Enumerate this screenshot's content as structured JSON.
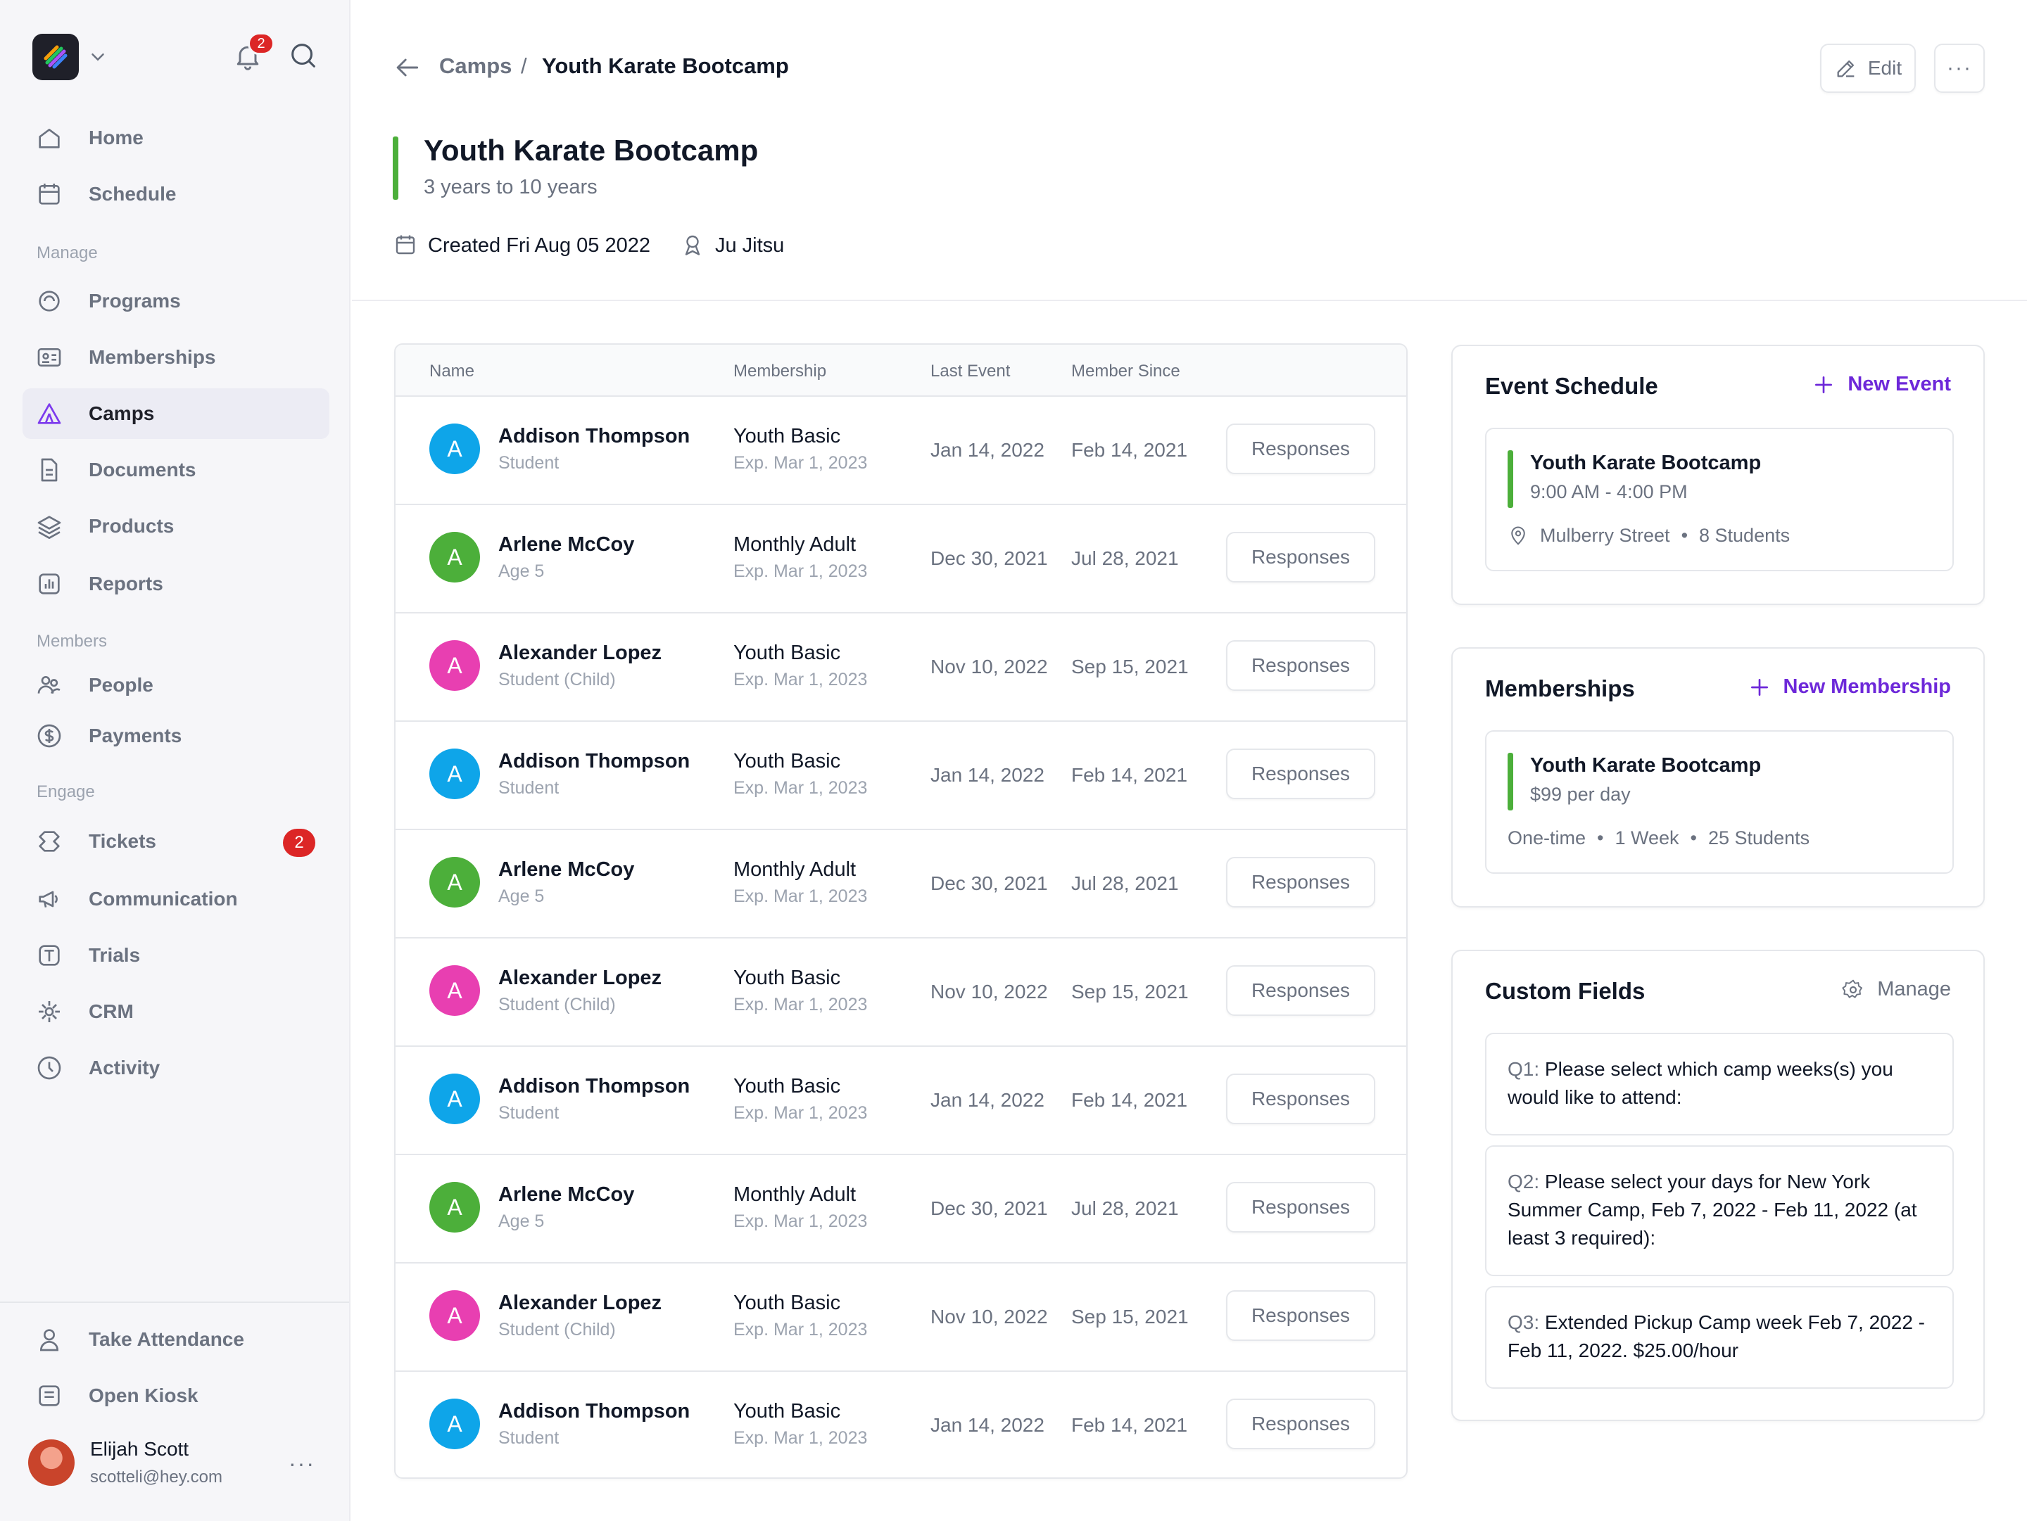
{
  "sidebar": {
    "notification_count": "2",
    "nav": [
      {
        "label": "Home",
        "icon": "home-icon"
      },
      {
        "label": "Schedule",
        "icon": "calendar-icon"
      }
    ],
    "manage_label": "Manage",
    "manage": [
      {
        "label": "Programs",
        "icon": "programs-icon"
      },
      {
        "label": "Memberships",
        "icon": "id-card-icon"
      },
      {
        "label": "Camps",
        "icon": "camp-tent-icon",
        "active": true
      },
      {
        "label": "Documents",
        "icon": "document-icon"
      },
      {
        "label": "Products",
        "icon": "layers-icon"
      },
      {
        "label": "Reports",
        "icon": "chart-icon"
      }
    ],
    "members_label": "Members",
    "members": [
      {
        "label": "People",
        "icon": "people-icon"
      },
      {
        "label": "Payments",
        "icon": "dollar-icon"
      }
    ],
    "engage_label": "Engage",
    "engage": [
      {
        "label": "Tickets",
        "icon": "ticket-icon",
        "badge": "2"
      },
      {
        "label": "Communication",
        "icon": "megaphone-icon"
      },
      {
        "label": "Trials",
        "icon": "trial-icon"
      },
      {
        "label": "CRM",
        "icon": "crm-icon"
      },
      {
        "label": "Activity",
        "icon": "clock-icon"
      }
    ],
    "bottom": [
      {
        "label": "Take Attendance",
        "icon": "user-icon"
      },
      {
        "label": "Open Kiosk",
        "icon": "kiosk-icon"
      }
    ],
    "user": {
      "name": "Elijah Scott",
      "email": "scotteli@hey.com"
    }
  },
  "header": {
    "breadcrumb_parent": "Camps",
    "breadcrumb_sep": "/",
    "breadcrumb_current": "Youth Karate Bootcamp",
    "edit_label": "Edit",
    "more_label": "···"
  },
  "camp": {
    "title": "Youth Karate Bootcamp",
    "subtitle": "3 years to 10 years",
    "created": "Created Fri Aug 05 2022",
    "style": "Ju Jitsu",
    "accent_color": "#4caf3a"
  },
  "table": {
    "columns": {
      "name": "Name",
      "membership": "Membership",
      "last_event": "Last Event",
      "member_since": "Member Since"
    },
    "action_label": "Responses",
    "rows": [
      {
        "initial": "A",
        "color": "#0ea5e9",
        "name": "Addison Thompson",
        "sub": "Student",
        "membership": "Youth Basic",
        "exp": "Exp. Mar 1, 2023",
        "last_event": "Jan 14, 2022",
        "member_since": "Feb 14, 2021"
      },
      {
        "initial": "A",
        "color": "#4caf3a",
        "name": "Arlene McCoy",
        "sub": "Age 5",
        "membership": "Monthly Adult",
        "exp": "Exp. Mar 1, 2023",
        "last_event": "Dec 30, 2021",
        "member_since": "Jul 28, 2021"
      },
      {
        "initial": "A",
        "color": "#e83fb1",
        "name": "Alexander Lopez",
        "sub": "Student (Child)",
        "membership": "Youth Basic",
        "exp": "Exp. Mar 1, 2023",
        "last_event": "Nov 10, 2022",
        "member_since": "Sep 15, 2021"
      },
      {
        "initial": "A",
        "color": "#0ea5e9",
        "name": "Addison Thompson",
        "sub": "Student",
        "membership": "Youth Basic",
        "exp": "Exp. Mar 1, 2023",
        "last_event": "Jan 14, 2022",
        "member_since": "Feb 14, 2021"
      },
      {
        "initial": "A",
        "color": "#4caf3a",
        "name": "Arlene McCoy",
        "sub": "Age 5",
        "membership": "Monthly Adult",
        "exp": "Exp. Mar 1, 2023",
        "last_event": "Dec 30, 2021",
        "member_since": "Jul 28, 2021"
      },
      {
        "initial": "A",
        "color": "#e83fb1",
        "name": "Alexander Lopez",
        "sub": "Student (Child)",
        "membership": "Youth Basic",
        "exp": "Exp. Mar 1, 2023",
        "last_event": "Nov 10, 2022",
        "member_since": "Sep 15, 2021"
      },
      {
        "initial": "A",
        "color": "#0ea5e9",
        "name": "Addison Thompson",
        "sub": "Student",
        "membership": "Youth Basic",
        "exp": "Exp. Mar 1, 2023",
        "last_event": "Jan 14, 2022",
        "member_since": "Feb 14, 2021"
      },
      {
        "initial": "A",
        "color": "#4caf3a",
        "name": "Arlene McCoy",
        "sub": "Age 5",
        "membership": "Monthly Adult",
        "exp": "Exp. Mar 1, 2023",
        "last_event": "Dec 30, 2021",
        "member_since": "Jul 28, 2021"
      },
      {
        "initial": "A",
        "color": "#e83fb1",
        "name": "Alexander Lopez",
        "sub": "Student (Child)",
        "membership": "Youth Basic",
        "exp": "Exp. Mar 1, 2023",
        "last_event": "Nov 10, 2022",
        "member_since": "Sep 15, 2021"
      },
      {
        "initial": "A",
        "color": "#0ea5e9",
        "name": "Addison Thompson",
        "sub": "Student",
        "membership": "Youth Basic",
        "exp": "Exp. Mar 1, 2023",
        "last_event": "Jan 14, 2022",
        "member_since": "Feb 14, 2021"
      }
    ]
  },
  "event_schedule": {
    "title": "Event Schedule",
    "action": "New Event",
    "event": {
      "title": "Youth Karate Bootcamp",
      "time": "9:00 AM - 4:00 PM",
      "location": "Mulberry Street",
      "students": "8 Students"
    }
  },
  "memberships": {
    "title": "Memberships",
    "action": "New Membership",
    "item": {
      "title": "Youth Karate Bootcamp",
      "price": "$99 per day",
      "type": "One-time",
      "duration": "1 Week",
      "students": "25 Students"
    }
  },
  "custom_fields": {
    "title": "Custom Fields",
    "action": "Manage",
    "questions": [
      {
        "no": "Q1:",
        "text": "Please select which camp weeks(s) you would like to attend:"
      },
      {
        "no": "Q2:",
        "text": "Please select your days for New York Summer Camp, Feb 7, 2022 - Feb 11, 2022 (at least 3 required):"
      },
      {
        "no": "Q3:",
        "text": "Extended Pickup Camp week Feb 7, 2022 - Feb 11, 2022. $25.00/hour"
      }
    ]
  },
  "colors": {
    "accent": "#6d28d9",
    "danger": "#dc2626",
    "success": "#4caf3a"
  }
}
